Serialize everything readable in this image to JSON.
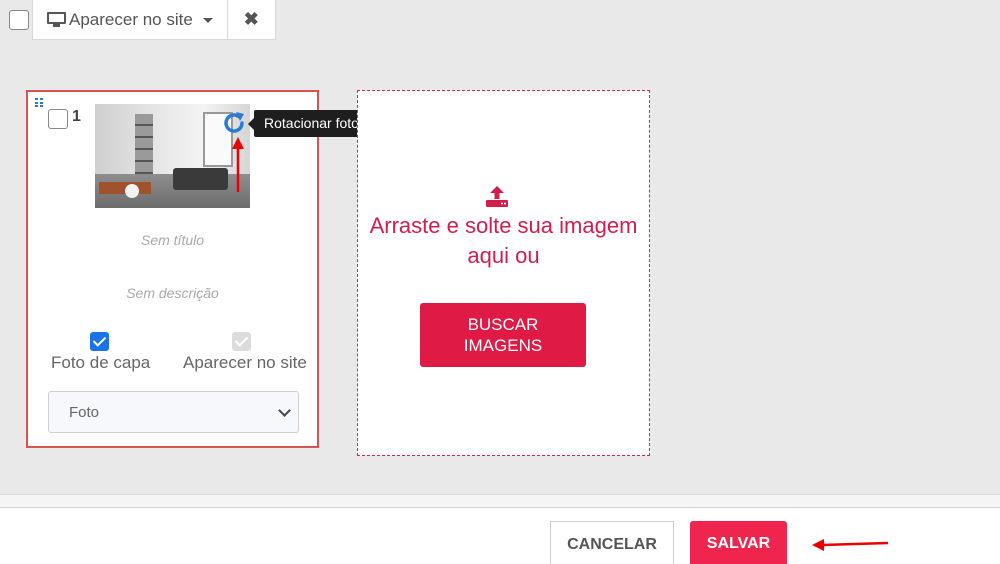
{
  "toolbar": {
    "visibility_label": "Aparecer no site",
    "icons": [
      "monitor-icon",
      "caret-down-icon",
      "close-icon"
    ]
  },
  "card": {
    "number": "1",
    "title_placeholder": "Sem título",
    "description_placeholder": "Sem descrição",
    "cover_label": "Foto de capa",
    "cover_checked": true,
    "show_on_site_label": "Aparecer no site",
    "show_on_site_checked": true,
    "show_on_site_disabled": true,
    "type_value": "Foto",
    "image_alt": "Foto de sala de estar com escritório",
    "tooltip": "Rotacionar foto"
  },
  "dropzone": {
    "text": "Arraste e solte sua imagem aqui ou",
    "button_label": "BUSCAR IMAGENS"
  },
  "footer": {
    "cancel_label": "CANCELAR",
    "save_label": "SALVAR"
  },
  "colors": {
    "accent": "#de1a45",
    "save": "#f0254d",
    "card_border": "#d9534f",
    "checkbox": "#1a73e8"
  }
}
